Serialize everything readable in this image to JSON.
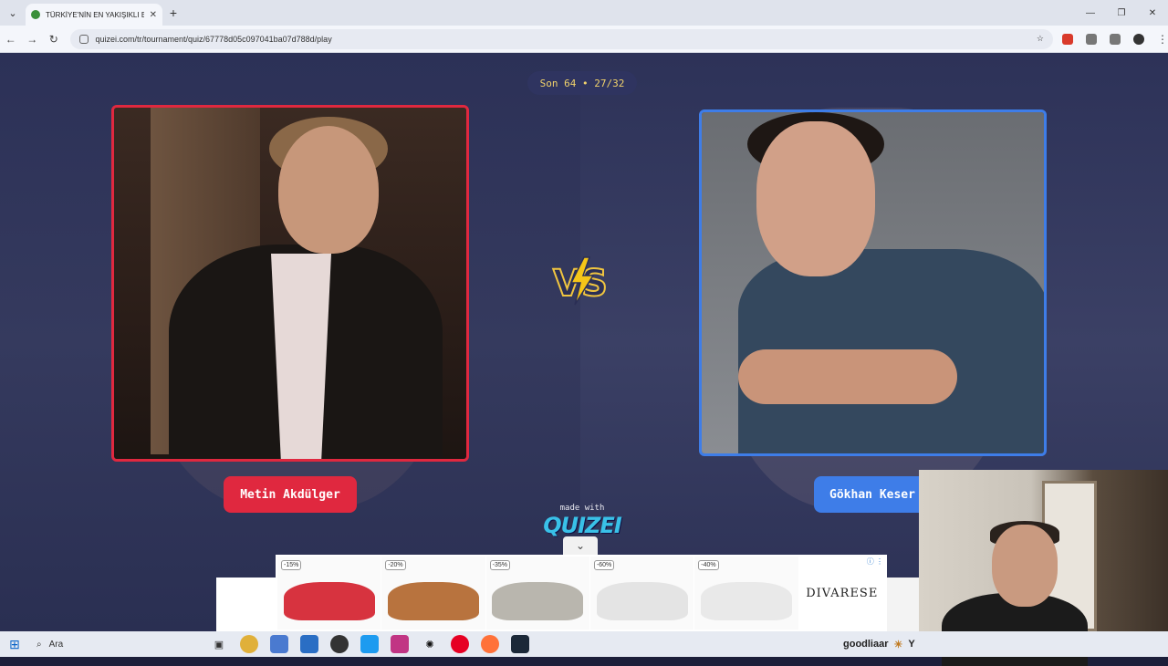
{
  "browser": {
    "tab_title": "TÜRKİYE'NİN EN YAKIŞIKLI ERKE",
    "url": "quizei.com/tr/tournament/quiz/67778d05c097041ba07d788d/play"
  },
  "page": {
    "round_label": "Son 64 • 27/32",
    "left_contestant": "Metin Akdülger",
    "right_contestant": "Gökhan Keser",
    "made_with": "made with",
    "logo_text": "QUIZEI",
    "colors": {
      "left_accent": "#e0283f",
      "right_accent": "#3e7de8",
      "round_text": "#f2d36b"
    }
  },
  "ad": {
    "products": [
      {
        "discount": "-15%",
        "color": "#d7333f"
      },
      {
        "discount": "-20%",
        "color": "#b8733e"
      },
      {
        "discount": "-35%",
        "color": "#b9b6ae"
      },
      {
        "discount": "-60%",
        "color": "#ececec"
      },
      {
        "discount": "-40%",
        "color": "#efefef"
      }
    ],
    "brand": "DIVARESE"
  },
  "taskbar": {
    "search_placeholder": "Ara",
    "tray_text": "goodliaar",
    "tray_suffix": "Y"
  }
}
